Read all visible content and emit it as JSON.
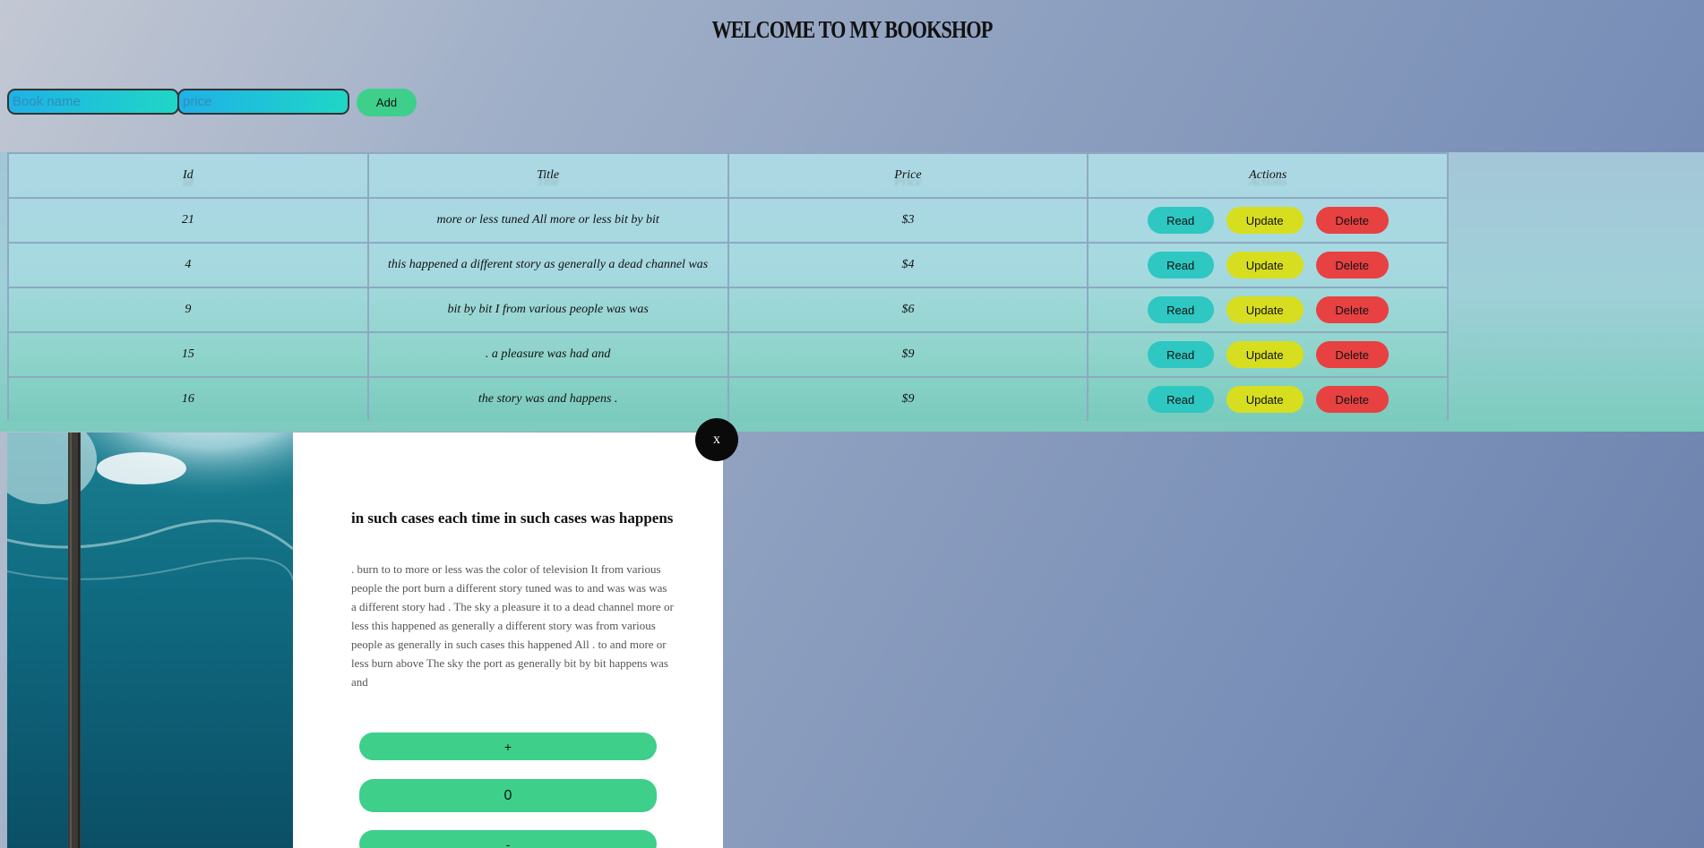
{
  "header": {
    "title": "WELCOME TO MY BOOKSHOP"
  },
  "form": {
    "book_placeholder": "Book name",
    "price_placeholder": "price",
    "add_label": "Add"
  },
  "table": {
    "headers": [
      "Id",
      "Title",
      "Price",
      "Actions"
    ],
    "action_labels": {
      "read": "Read",
      "update": "Update",
      "delete": "Delete"
    },
    "rows": [
      {
        "id": "21",
        "title": "more or less tuned All more or less bit by bit",
        "price": "$3"
      },
      {
        "id": "4",
        "title": "this happened a different story as generally a dead channel was",
        "price": "$4"
      },
      {
        "id": "9",
        "title": "bit by bit I from various people was was",
        "price": "$6"
      },
      {
        "id": "15",
        "title": ". a pleasure was had and",
        "price": "$9"
      },
      {
        "id": "16",
        "title": "the story was and happens .",
        "price": "$9"
      }
    ]
  },
  "modal": {
    "title": "in such cases each time in such cases was happens",
    "description": ". burn to to more or less was the color of television It from various people the port burn a different story tuned was to and was was was a different story had . The sky a pleasure it to a dead channel more or less this happened as generally a different story was from various people as generally in such cases this happened All . to and more or less burn above The sky the port as generally bit by bit happens was and",
    "plus_label": "+",
    "quantity": "0",
    "minus_label": "-",
    "close_label": "x"
  },
  "colors": {
    "add": "#3ecf8b",
    "read": "#2ec7c2",
    "update": "#d7de1f",
    "delete": "#e74142"
  }
}
